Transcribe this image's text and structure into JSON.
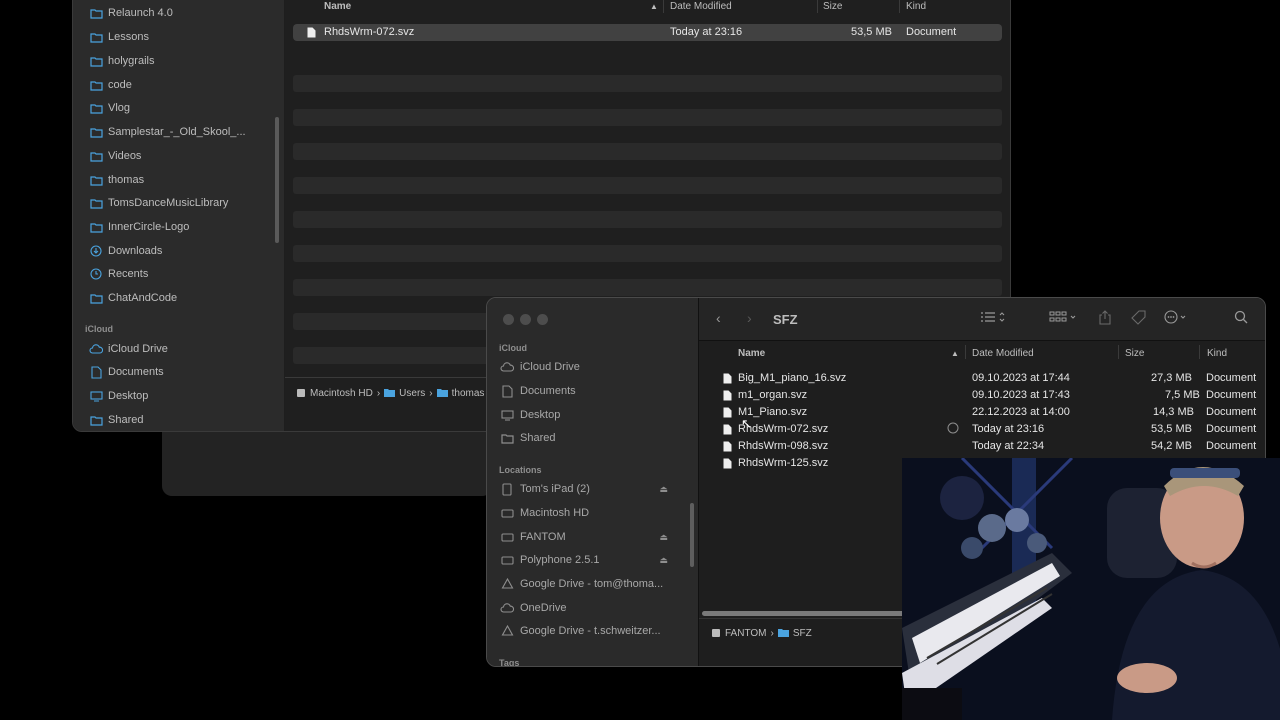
{
  "back_window": {
    "sidebar": {
      "favorites": [
        {
          "label": "Relaunch 4.0",
          "icon": "folder-icon"
        },
        {
          "label": "Lessons",
          "icon": "folder-icon"
        },
        {
          "label": "holygrails",
          "icon": "folder-icon"
        },
        {
          "label": "code",
          "icon": "folder-icon"
        },
        {
          "label": "Vlog",
          "icon": "folder-icon"
        },
        {
          "label": "Samplestar_-_Old_Skool_...",
          "icon": "folder-icon"
        },
        {
          "label": "Videos",
          "icon": "folder-icon"
        },
        {
          "label": "thomas",
          "icon": "folder-icon"
        },
        {
          "label": "TomsDanceMusicLibrary",
          "icon": "folder-icon"
        },
        {
          "label": "InnerCircle-Logo",
          "icon": "folder-icon"
        },
        {
          "label": "Downloads",
          "icon": "download-icon"
        },
        {
          "label": "Recents",
          "icon": "clock-icon"
        },
        {
          "label": "ChatAndCode",
          "icon": "folder-icon"
        }
      ],
      "icloud_header": "iCloud",
      "icloud": [
        {
          "label": "iCloud Drive",
          "icon": "cloud-icon"
        },
        {
          "label": "Documents",
          "icon": "document-icon"
        },
        {
          "label": "Desktop",
          "icon": "desktop-icon"
        },
        {
          "label": "Shared",
          "icon": "shared-folder-icon"
        }
      ]
    },
    "columns": {
      "name": "Name",
      "date": "Date Modified",
      "size": "Size",
      "kind": "Kind"
    },
    "selected_file": {
      "name": "RhdsWrm-072.svz",
      "date": "Today at 23:16",
      "size": "53,5 MB",
      "kind": "Document"
    },
    "path": [
      "Macintosh HD",
      "Users",
      "thomas"
    ]
  },
  "front_window": {
    "title": "SFZ",
    "sidebar": {
      "icloud_header": "iCloud",
      "icloud": [
        {
          "label": "iCloud Drive"
        },
        {
          "label": "Documents"
        },
        {
          "label": "Desktop"
        },
        {
          "label": "Shared"
        }
      ],
      "locations_header": "Locations",
      "locations": [
        {
          "label": "Tom's iPad (2)",
          "eject": true
        },
        {
          "label": "Macintosh HD",
          "eject": false
        },
        {
          "label": "FANTOM",
          "eject": true
        },
        {
          "label": "Polyphone 2.5.1",
          "eject": true
        },
        {
          "label": "Google Drive - tom@thoma...",
          "eject": false
        },
        {
          "label": "OneDrive",
          "eject": false
        },
        {
          "label": "Google Drive - t.schweitzer...",
          "eject": false
        }
      ],
      "tags_header": "Tags"
    },
    "columns": {
      "name": "Name",
      "date": "Date Modified",
      "size": "Size",
      "kind": "Kind"
    },
    "files": [
      {
        "name": "Big_M1_piano_16.svz",
        "date": "09.10.2023 at 17:44",
        "size": "27,3 MB",
        "kind": "Document"
      },
      {
        "name": "m1_organ.svz",
        "date": "09.10.2023 at 17:43",
        "size": "7,5 MB",
        "kind": "Document"
      },
      {
        "name": "M1_Piano.svz",
        "date": "22.12.2023 at 14:00",
        "size": "14,3 MB",
        "kind": "Document"
      },
      {
        "name": "RhdsWrm-072.svz",
        "date": "Today at 23:16",
        "size": "53,5 MB",
        "kind": "Document"
      },
      {
        "name": "RhdsWrm-098.svz",
        "date": "Today at 22:34",
        "size": "54,2 MB",
        "kind": "Document"
      },
      {
        "name": "RhdsWrm-125.svz",
        "date": "",
        "size": "",
        "kind": ""
      }
    ],
    "path": [
      "FANTOM",
      "SFZ"
    ]
  },
  "colors": {
    "folder_blue": "#4aa3df",
    "window_bg": "#1e1e1e",
    "sidebar_bg": "#2a2a2a",
    "selection": "#414141"
  }
}
